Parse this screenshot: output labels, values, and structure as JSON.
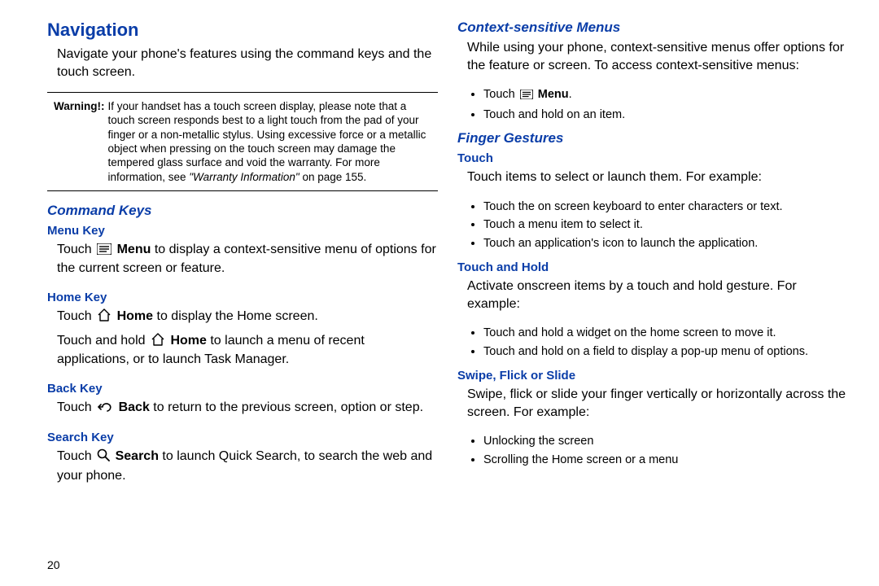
{
  "left": {
    "h1": "Navigation",
    "intro": "Navigate your phone's features using the command keys and the touch screen.",
    "warning_label": "Warning!:",
    "warning_text_1": "If your handset has a touch screen display, please note that a touch screen responds best to a light touch from the pad of your finger or a non-metallic stylus. Using excessive force or a metallic object when pressing on the touch screen may damage the tempered glass surface and void the warranty. For more information, see ",
    "warning_ref": "\"Warranty Information\"",
    "warning_text_2": " on page 155.",
    "h2_command": "Command Keys",
    "menu_h": "Menu Key",
    "menu_p_a": "Touch ",
    "menu_bold": "Menu",
    "menu_p_b": " to display a context-sensitive menu of options for the current screen or feature.",
    "home_h": "Home Key",
    "home_p1_a": "Touch ",
    "home_p1_bold": "Home",
    "home_p1_b": " to display the Home screen.",
    "home_p2_a": "Touch and hold ",
    "home_p2_bold": "Home",
    "home_p2_b": " to launch a menu of recent applications, or to launch Task Manager.",
    "back_h": "Back Key",
    "back_p_a": "Touch ",
    "back_bold": "Back",
    "back_p_b": " to return to the previous screen, option or step.",
    "search_h": "Search Key",
    "search_p_a": "Touch ",
    "search_bold": "Search",
    "search_p_b": " to launch Quick Search, to search the web and your phone.",
    "page_number": "20"
  },
  "right": {
    "h2_ctx": "Context-sensitive Menus",
    "ctx_intro": "While using your phone, context-sensitive menus offer options for the feature or screen. To access context-sensitive menus:",
    "ctx_b1_a": "Touch ",
    "ctx_b1_bold": "Menu",
    "ctx_b1_b": ".",
    "ctx_b2": "Touch and hold on an item.",
    "h2_fg": "Finger Gestures",
    "touch_h": "Touch",
    "touch_intro": "Touch items to select or launch them. For example:",
    "touch_b1": "Touch the on screen keyboard to enter characters or text.",
    "touch_b2": "Touch a menu item to select it.",
    "touch_b3": "Touch an application's icon to launch the application.",
    "th_h": "Touch and Hold",
    "th_intro": "Activate onscreen items by a touch and hold gesture. For example:",
    "th_b1": "Touch and hold a widget on the home screen to move it.",
    "th_b2": "Touch and hold on a field to display a pop-up menu of options.",
    "sfs_h": "Swipe, Flick or Slide",
    "sfs_intro": "Swipe, flick or slide your finger vertically or horizontally across the screen. For example:",
    "sfs_b1": "Unlocking the screen",
    "sfs_b2": "Scrolling the Home screen or a menu"
  }
}
